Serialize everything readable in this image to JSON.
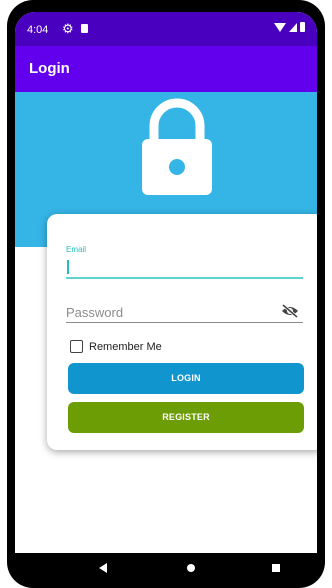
{
  "status_bar": {
    "time": "4:04",
    "icons": [
      "settings-icon",
      "sd-card-icon",
      "wifi-icon",
      "signal-icon",
      "battery-icon"
    ]
  },
  "app_bar": {
    "title": "Login"
  },
  "hero": {
    "icon": "lock-icon",
    "color": "#34b5e5"
  },
  "form": {
    "email": {
      "label": "Email",
      "value": ""
    },
    "password": {
      "placeholder": "Password",
      "toggle_icon": "visibility-off-icon"
    },
    "remember_me": {
      "label": "Remember Me",
      "checked": false
    },
    "login_button": {
      "label": "LOGIN",
      "color": "#1195cf"
    },
    "register_button": {
      "label": "REGISTER",
      "color": "#6d9d05"
    }
  },
  "nav_bar": {
    "icons": [
      "back-icon",
      "home-icon",
      "recents-icon"
    ]
  },
  "colors": {
    "status_bar": "#4a00bf",
    "app_bar": "#6200ee",
    "accent": "#22bfbd"
  }
}
